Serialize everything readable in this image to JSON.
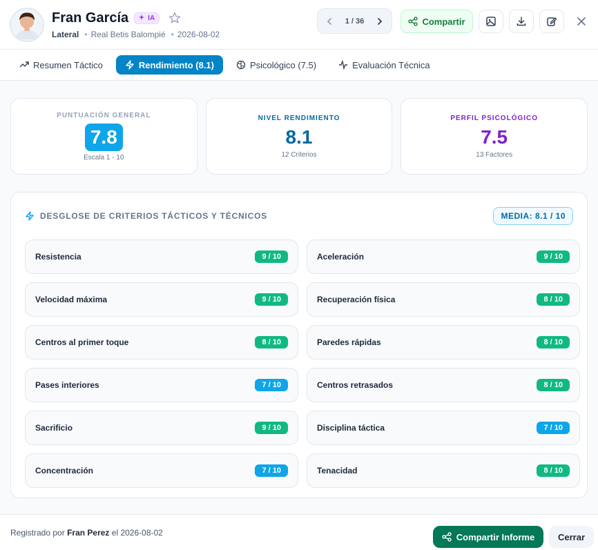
{
  "player": {
    "name": "Fran García",
    "ai_badge": "IA",
    "position": "Lateral",
    "club": "Real Betis Balompié",
    "date": "2026-08-02"
  },
  "pager": {
    "label": "1 / 36"
  },
  "toolbar": {
    "share_label": "Compartir"
  },
  "tabs": [
    {
      "label": "Resumen Táctico",
      "icon": "trend-up-icon",
      "active": false
    },
    {
      "label": "Rendimiento (8.1)",
      "icon": "lightning-icon",
      "active": true
    },
    {
      "label": "Psicológico (7.5)",
      "icon": "brain-icon",
      "active": false
    },
    {
      "label": "Evaluación Técnica",
      "icon": "pulse-icon",
      "active": false
    }
  ],
  "kpis": [
    {
      "label": "PUNTUACIÓN GENERAL",
      "value": "7.8",
      "note": "Escala 1 - 10",
      "color": "#94a3b8"
    },
    {
      "label": "NIVEL RENDIMIENTO",
      "value": "8.1",
      "note": "12 Criterios",
      "color": "#0369a1"
    },
    {
      "label": "PERFIL PSICOLÓGICO",
      "value": "7.5",
      "note": "13 Factores",
      "color": "#7e22ce"
    }
  ],
  "breakdown": {
    "title": "DESGLOSE DE CRITERIOS TÁCTICOS Y TÉCNICOS",
    "average": "MEDIA: 8.1 / 10",
    "criteria": [
      {
        "name": "Resistencia",
        "score": "9 / 10"
      },
      {
        "name": "Aceleración",
        "score": "9 / 10"
      },
      {
        "name": "Velocidad máxima",
        "score": "9 / 10"
      },
      {
        "name": "Recuperación física",
        "score": "8 / 10"
      },
      {
        "name": "Centros al primer toque",
        "score": "8 / 10"
      },
      {
        "name": "Paredes rápidas",
        "score": "8 / 10"
      },
      {
        "name": "Pases interiores",
        "score": "7 / 10"
      },
      {
        "name": "Centros retrasados",
        "score": "8 / 10"
      },
      {
        "name": "Sacrificio",
        "score": "9 / 10"
      },
      {
        "name": "Disciplina táctica",
        "score": "7 / 10"
      },
      {
        "name": "Concentración",
        "score": "7 / 10"
      },
      {
        "name": "Tenacidad",
        "score": "8 / 10"
      }
    ]
  },
  "footer": {
    "registered_prefix": "Registrado por",
    "author": "Fran Perez",
    "date_prefix": "el",
    "date": "2026-08-02",
    "share_report_label": "Compartir Informe",
    "close_label": "Cerrar"
  },
  "colors": {
    "score_high": "#10b981",
    "score_mid": "#0ea5e9",
    "primary": "#0284c7",
    "share_green": "#047857"
  }
}
